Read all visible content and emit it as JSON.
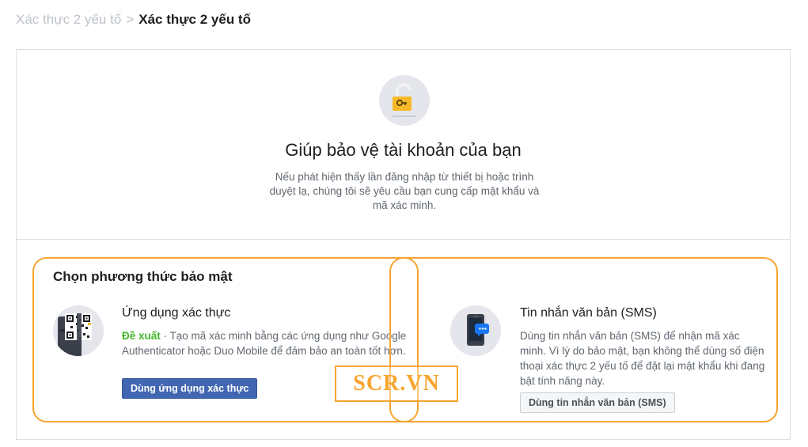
{
  "breadcrumb": {
    "parent": "Xác thực 2 yếu tố",
    "separator": ">",
    "current": "Xác thực 2 yếu tố"
  },
  "hero": {
    "icon": "lock-key-icon",
    "title": "Giúp bảo vệ tài khoản của bạn",
    "description": "Nếu phát hiện thấy lần đăng nhập từ thiết bị hoặc trình duyệt lạ, chúng tôi sẽ yêu cầu bạn cung cấp mật khẩu và mã xác minh."
  },
  "methods": {
    "heading": "Chọn phương thức bảo mật",
    "authenticator": {
      "icon": "authenticator-app-icon",
      "title": "Ứng dụng xác thực",
      "badge": "Đề xuất",
      "separator": " · ",
      "description": "Tạo mã xác minh bằng các ứng dụng như Google Authenticator hoặc Duo Mobile để đảm bảo an toàn tốt hơn.",
      "button": "Dùng ứng dụng xác thực"
    },
    "sms": {
      "icon": "sms-phone-icon",
      "title": "Tin nhắn văn bản (SMS)",
      "description": "Dùng tin nhắn văn bản (SMS) để nhận mã xác minh. Vì lý do bảo mật, bạn không thể dùng số điện thoại xác thực 2 yếu tố để đặt lại mật khẩu khi đang bật tính năng này.",
      "button": "Dùng tin nhắn văn bản (SMS)"
    }
  },
  "watermark": "SCR.VN",
  "colors": {
    "primary_button": "#4267b2",
    "recommend": "#42b72a",
    "highlight": "#f7a530",
    "border": "#dddfe2"
  }
}
